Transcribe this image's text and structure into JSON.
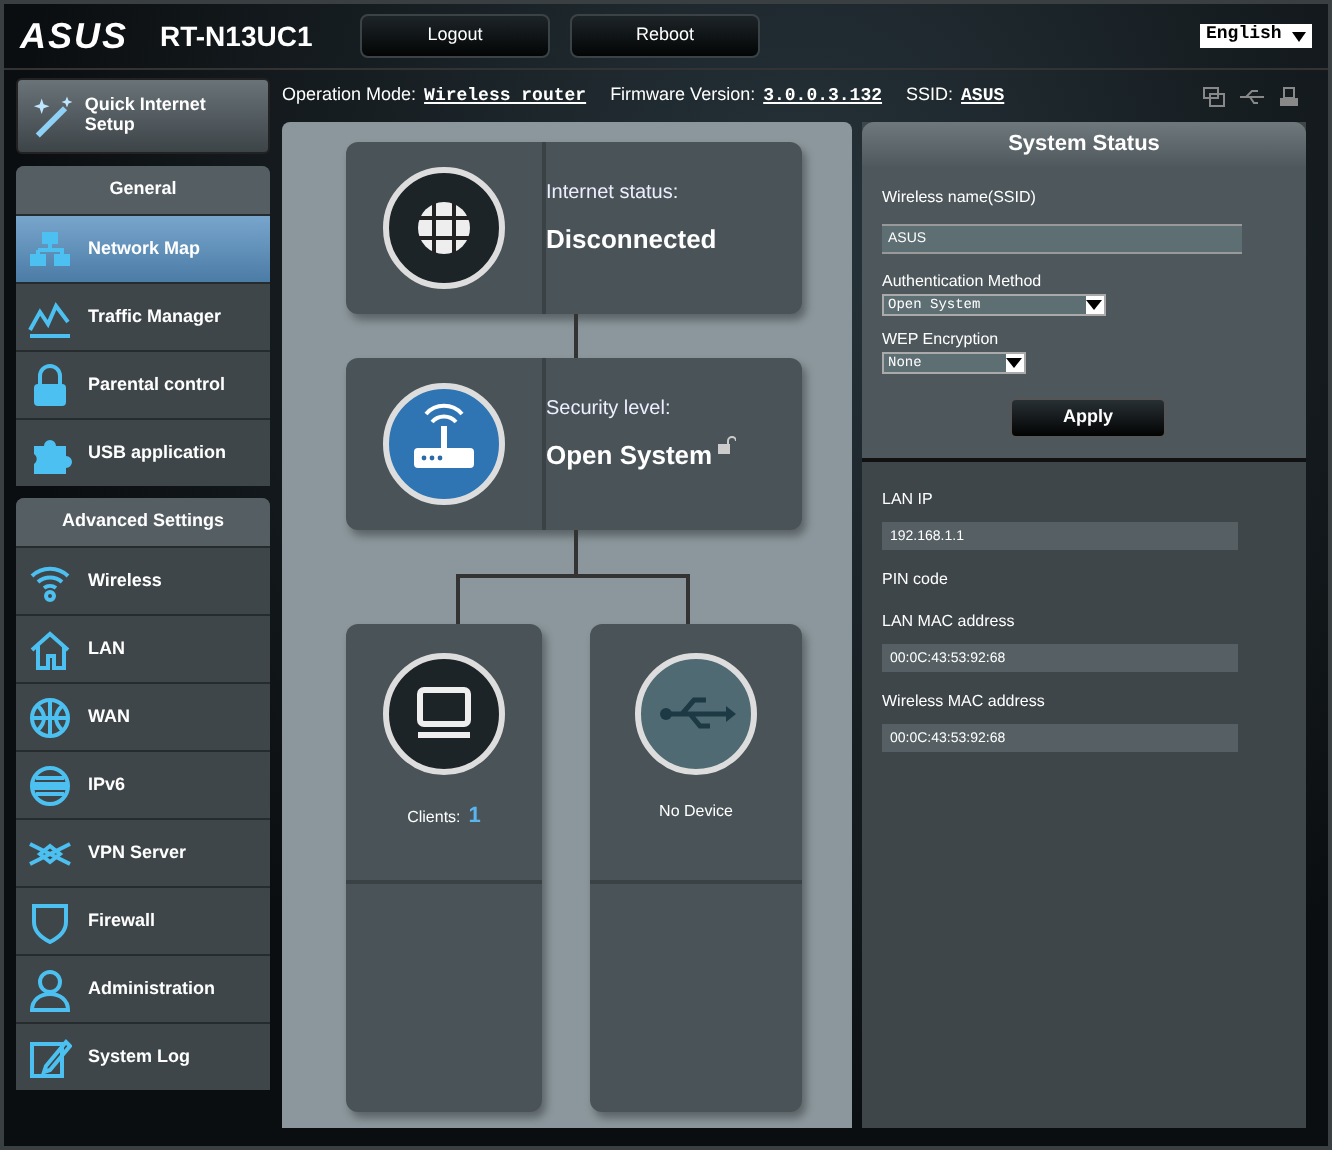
{
  "header": {
    "logo": "ASUS",
    "model": "RT-N13UC1",
    "buttons": [
      "Logout",
      "Reboot"
    ],
    "language": "English"
  },
  "quick_setup": "Quick Internet Setup",
  "info_bar": [
    {
      "label": "Operation Mode:",
      "value": "Wireless router"
    },
    {
      "label": "Firmware Version:",
      "value": "3.0.0.3.132"
    },
    {
      "label": "SSID:",
      "value": "ASUS"
    }
  ],
  "sidebar": [
    {
      "heading": "General",
      "items": [
        {
          "label": "Network Map",
          "selected": true
        },
        {
          "label": "Traffic Manager",
          "selected": false
        },
        {
          "label": "Parental control",
          "selected": false
        },
        {
          "label": "USB application",
          "selected": false
        }
      ]
    },
    {
      "heading": "Advanced Settings",
      "items": [
        {
          "label": "Wireless",
          "selected": false
        },
        {
          "label": "LAN",
          "selected": false
        },
        {
          "label": "WAN",
          "selected": false
        },
        {
          "label": "IPv6",
          "selected": false
        },
        {
          "label": "VPN Server",
          "selected": false
        },
        {
          "label": "Firewall",
          "selected": false
        },
        {
          "label": "Administration",
          "selected": false
        },
        {
          "label": "System Log",
          "selected": false
        }
      ]
    }
  ],
  "network_map": {
    "internet": {
      "label": "Internet status:",
      "value": "Disconnected"
    },
    "security": {
      "label": "Security level:",
      "value": "Open System"
    },
    "clients": {
      "label": "Clients:",
      "count": "1"
    },
    "usb": {
      "label": "No Device"
    }
  },
  "system_status": {
    "title": "System Status",
    "settings": [
      {
        "kind": "input",
        "label": "Wireless name(SSID)",
        "value": "ASUS"
      },
      {
        "kind": "select",
        "label": "Authentication Method",
        "value": "Open System"
      },
      {
        "kind": "select",
        "label": "WEP Encryption",
        "value": "None"
      }
    ],
    "apply": "Apply",
    "info": [
      {
        "label": "LAN IP",
        "value": "192.168.1.1"
      },
      {
        "label": "PIN code"
      },
      {
        "label": "LAN MAC address",
        "value": "00:0C:43:53:92:68"
      },
      {
        "label": "Wireless MAC address",
        "value": "00:0C:43:53:92:68"
      }
    ]
  }
}
